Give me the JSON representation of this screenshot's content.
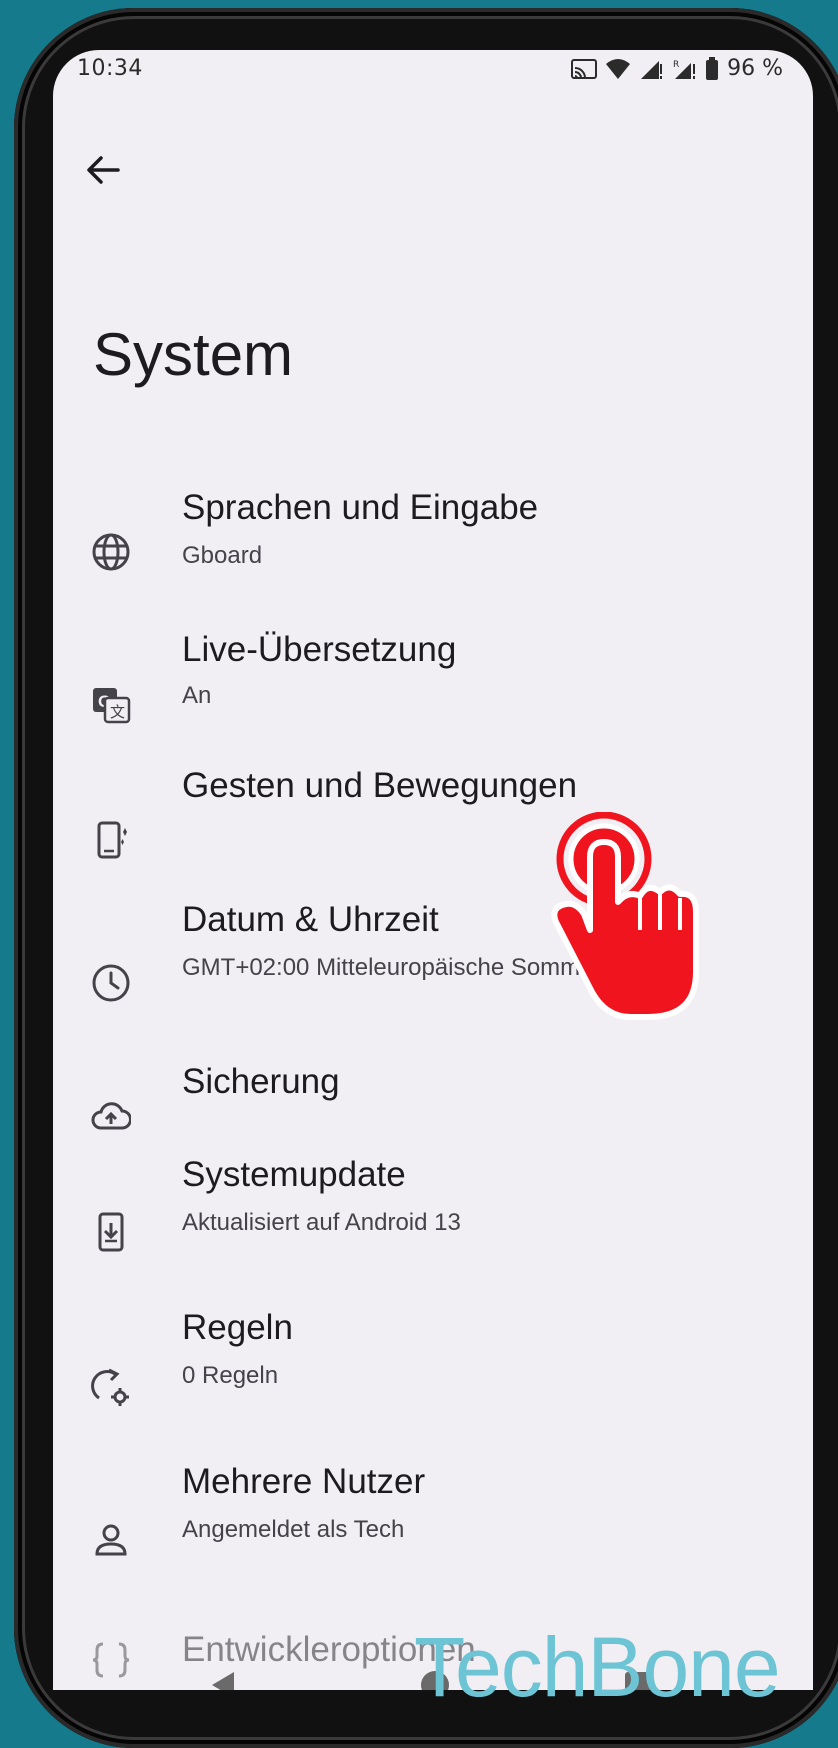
{
  "status_bar": {
    "time": "10:34",
    "battery": "96 %",
    "icons": [
      "cast-icon",
      "wifi-icon",
      "signal-icon",
      "signal-roaming-icon",
      "battery-icon"
    ]
  },
  "header": {
    "back_icon": "arrow-back-icon",
    "title": "System"
  },
  "settings": [
    {
      "icon": "globe-icon",
      "title": "Sprachen und Eingabe",
      "subtitle": "Gboard"
    },
    {
      "icon": "translate-icon",
      "title": "Live-Übersetzung",
      "subtitle": "An"
    },
    {
      "icon": "gesture-phone-icon",
      "title": "Gesten und Bewegungen",
      "subtitle": ""
    },
    {
      "icon": "clock-icon",
      "title": "Datum & Uhrzeit",
      "subtitle": "GMT+02:00 Mitteleuropäische Sommerzeit"
    },
    {
      "icon": "cloud-upload-icon",
      "title": "Sicherung",
      "subtitle": ""
    },
    {
      "icon": "system-update-icon",
      "title": "Systemupdate",
      "subtitle": "Aktualisiert auf Android 13"
    },
    {
      "icon": "rules-icon",
      "title": "Regeln",
      "subtitle": "0 Regeln"
    },
    {
      "icon": "person-icon",
      "title": "Mehrere Nutzer",
      "subtitle": "Angemeldet als Tech"
    },
    {
      "icon": "code-braces-icon",
      "title": "Entwickleroptionen",
      "subtitle": ""
    }
  ],
  "watermark": "TechBone",
  "colors": {
    "background": "#147a8c",
    "screen": "#f1eff3",
    "tap_indicator": "#f0141e",
    "watermark": "#6cc4d4"
  }
}
